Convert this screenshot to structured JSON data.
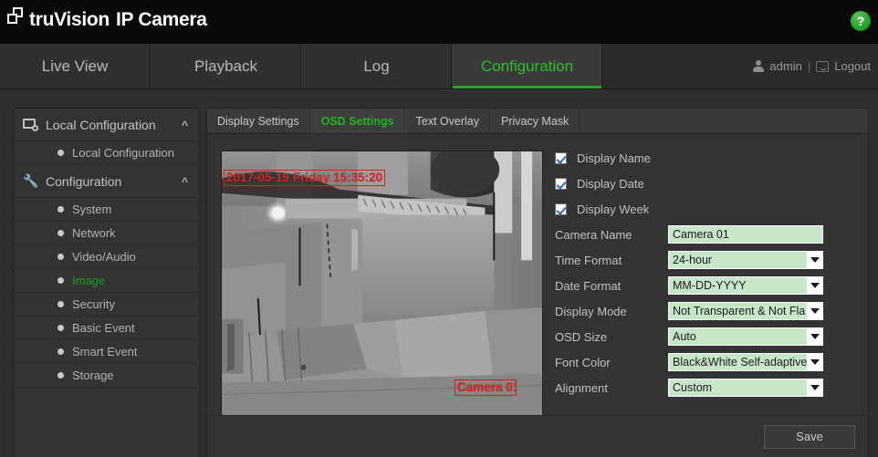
{
  "header": {
    "brand_pre": "tru",
    "brand_post": "Vision",
    "brand_suffix": "IP Camera",
    "help_label": "?",
    "logo_icon": "overlapping-squares-logo"
  },
  "nav": {
    "tabs": [
      {
        "label": "Live View",
        "active": false
      },
      {
        "label": "Playback",
        "active": false
      },
      {
        "label": "Log",
        "active": false
      },
      {
        "label": "Configuration",
        "active": true
      }
    ],
    "user": "admin",
    "separator": "|",
    "logout": "Logout",
    "user_icon": "user-icon",
    "logout_icon": "logout-icon",
    "active_color": "#2cbf2c"
  },
  "sidebar": {
    "groups": [
      {
        "title": "Local Configuration",
        "icon": "monitor-gear-icon",
        "chevron": "^",
        "items": [
          {
            "label": "Local Configuration",
            "active": false
          }
        ]
      },
      {
        "title": "Configuration",
        "icon": "wrench-icon",
        "chevron": "^",
        "items": [
          {
            "label": "System",
            "active": false
          },
          {
            "label": "Network",
            "active": false
          },
          {
            "label": "Video/Audio",
            "active": false
          },
          {
            "label": "Image",
            "active": true
          },
          {
            "label": "Security",
            "active": false
          },
          {
            "label": "Basic Event",
            "active": false
          },
          {
            "label": "Smart Event",
            "active": false
          },
          {
            "label": "Storage",
            "active": false
          }
        ]
      }
    ],
    "active_color": "#20a020"
  },
  "content": {
    "tabs": [
      {
        "label": "Display Settings",
        "active": false
      },
      {
        "label": "OSD Settings",
        "active": true
      },
      {
        "label": "Text Overlay",
        "active": false
      },
      {
        "label": "Privacy Mask",
        "active": false
      }
    ]
  },
  "preview": {
    "osd_datetime": "2017-05-19 Friday 15:35:20",
    "osd_camera_name": "Camera 01",
    "osd_box_color": "#e22222"
  },
  "form": {
    "checkboxes": [
      {
        "label": "Display Name",
        "checked": true
      },
      {
        "label": "Display Date",
        "checked": true
      },
      {
        "label": "Display Week",
        "checked": true
      }
    ],
    "fields": [
      {
        "label": "Camera Name",
        "value": "Camera 01",
        "type": "text"
      },
      {
        "label": "Time Format",
        "value": "24-hour",
        "type": "select"
      },
      {
        "label": "Date Format",
        "value": "MM-DD-YYYY",
        "type": "select"
      },
      {
        "label": "Display Mode",
        "value": "Not Transparent & Not Fla",
        "type": "select"
      },
      {
        "label": "OSD Size",
        "value": "Auto",
        "type": "select"
      },
      {
        "label": "Font Color",
        "value": "Black&White Self-adaptive",
        "type": "select"
      },
      {
        "label": "Alignment",
        "value": "Custom",
        "type": "select"
      }
    ],
    "field_bg": "#c8e6c9"
  },
  "footer": {
    "save_label": "Save"
  }
}
